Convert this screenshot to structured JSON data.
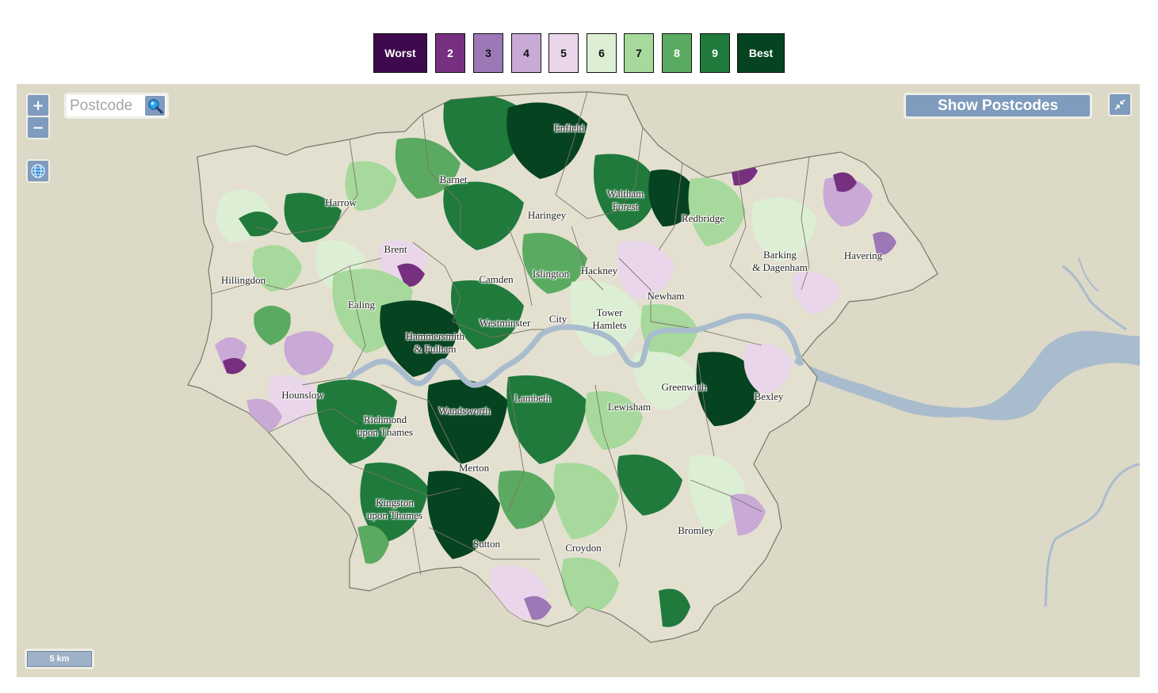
{
  "legend": {
    "items": [
      {
        "label": "Worst",
        "bg": "#3f0a4d",
        "fg": "#ffffff"
      },
      {
        "label": "2",
        "bg": "#76307f",
        "fg": "#ffffff"
      },
      {
        "label": "3",
        "bg": "#9c78b7",
        "fg": "#111111"
      },
      {
        "label": "4",
        "bg": "#c9a9d5",
        "fg": "#111111"
      },
      {
        "label": "5",
        "bg": "#ead6ea",
        "fg": "#111111"
      },
      {
        "label": "6",
        "bg": "#dcefd4",
        "fg": "#111111"
      },
      {
        "label": "7",
        "bg": "#a6d99b",
        "fg": "#111111"
      },
      {
        "label": "8",
        "bg": "#5baa61",
        "fg": "#ffffff"
      },
      {
        "label": "9",
        "bg": "#1f7a3c",
        "fg": "#ffffff"
      },
      {
        "label": "Best",
        "bg": "#064320",
        "fg": "#ffffff"
      }
    ]
  },
  "controls": {
    "zoom_in": "+",
    "zoom_out": "−",
    "search_placeholder": "Postcode",
    "show_postcodes": "Show Postcodes",
    "scale_label": "5 km"
  },
  "colors": {
    "land": "#dcd9c6",
    "water": "#a9bccd",
    "boundary": "#7a7668",
    "button": "#7f9bbd"
  },
  "boroughs": [
    {
      "name": "Enfield"
    },
    {
      "name": "Barnet"
    },
    {
      "name": "Harrow"
    },
    {
      "name": "Waltham\nForest"
    },
    {
      "name": "Haringey"
    },
    {
      "name": "Redbridge"
    },
    {
      "name": "Brent"
    },
    {
      "name": "Barking\n& Dagenham"
    },
    {
      "name": "Havering"
    },
    {
      "name": "Hillingdon"
    },
    {
      "name": "Camden"
    },
    {
      "name": "Islington"
    },
    {
      "name": "Hackney"
    },
    {
      "name": "Newham"
    },
    {
      "name": "Ealing"
    },
    {
      "name": "Westminster"
    },
    {
      "name": "City"
    },
    {
      "name": "Tower\nHamlets"
    },
    {
      "name": "Hammersmith\n& Fulham"
    },
    {
      "name": "Greenwich"
    },
    {
      "name": "Hounslow"
    },
    {
      "name": "Bexley"
    },
    {
      "name": "Lambeth"
    },
    {
      "name": "Wandsworth"
    },
    {
      "name": "Lewisham"
    },
    {
      "name": "Richmond\nupon Thames"
    },
    {
      "name": "Merton"
    },
    {
      "name": "Kingston\nupon Thames"
    },
    {
      "name": "Bromley"
    },
    {
      "name": "Sutton"
    },
    {
      "name": "Croydon"
    }
  ]
}
